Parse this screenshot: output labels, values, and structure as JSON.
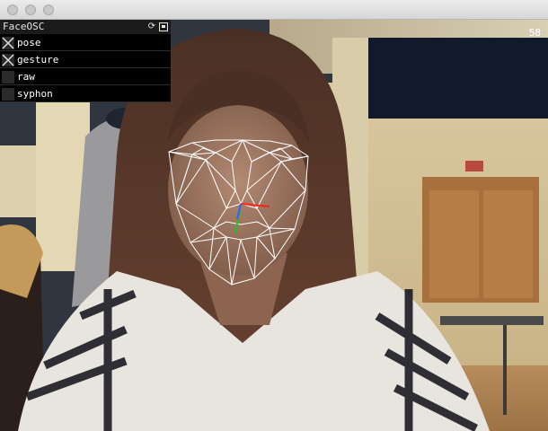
{
  "window": {
    "title": ""
  },
  "app": {
    "fps": "58"
  },
  "gui": {
    "title": "FaceOSC",
    "header_icons": [
      "refresh-icon",
      "save-icon"
    ],
    "toggles": [
      {
        "label": "pose",
        "checked": true
      },
      {
        "label": "gesture",
        "checked": true
      },
      {
        "label": "raw",
        "checked": false
      },
      {
        "label": "syphon",
        "checked": false
      }
    ]
  },
  "colors": {
    "mesh": "#ffffff",
    "pose_x_axis": "#ff2020",
    "pose_y_axis": "#22c022",
    "pose_z_axis": "#3060ff",
    "gui_background": "#000000",
    "titlebar": "#e0e0e0"
  }
}
